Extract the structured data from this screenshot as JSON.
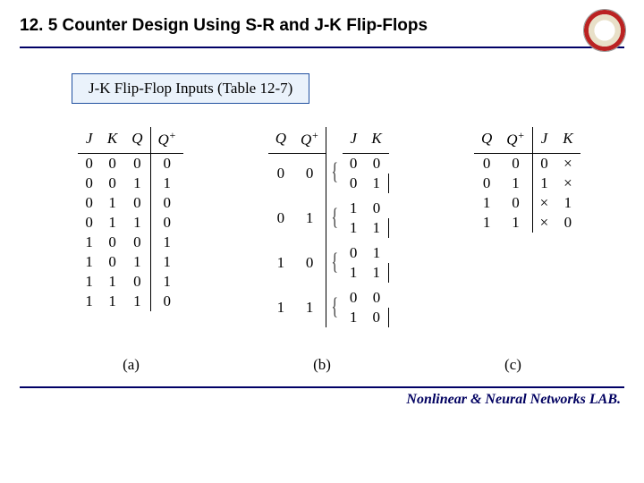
{
  "title": "12. 5 Counter Design Using S-R and J-K Flip-Flops",
  "subtitle": "J-K Flip-Flop Inputs (Table 12-7)",
  "tableA": {
    "headers": [
      "J",
      "K",
      "Q",
      "Q+"
    ],
    "rows": [
      [
        "0",
        "0",
        "0",
        "0"
      ],
      [
        "0",
        "0",
        "1",
        "1"
      ],
      [
        "0",
        "1",
        "0",
        "0"
      ],
      [
        "0",
        "1",
        "1",
        "0"
      ],
      [
        "1",
        "0",
        "0",
        "1"
      ],
      [
        "1",
        "0",
        "1",
        "1"
      ],
      [
        "1",
        "1",
        "0",
        "1"
      ],
      [
        "1",
        "1",
        "1",
        "0"
      ]
    ]
  },
  "tableB": {
    "headers": [
      "Q",
      "Q+",
      "J",
      "K"
    ],
    "groups": [
      {
        "left": [
          "0",
          "0"
        ],
        "pairs": [
          [
            "0",
            "0"
          ],
          [
            "0",
            "1"
          ]
        ]
      },
      {
        "left": [
          "0",
          "1"
        ],
        "pairs": [
          [
            "1",
            "0"
          ],
          [
            "1",
            "1"
          ]
        ]
      },
      {
        "left": [
          "1",
          "0"
        ],
        "pairs": [
          [
            "0",
            "1"
          ],
          [
            "1",
            "1"
          ]
        ]
      },
      {
        "left": [
          "1",
          "1"
        ],
        "pairs": [
          [
            "0",
            "0"
          ],
          [
            "1",
            "0"
          ]
        ]
      }
    ]
  },
  "tableC": {
    "headers": [
      "Q",
      "Q+",
      "J",
      "K"
    ],
    "rows": [
      [
        "0",
        "0",
        "0",
        "×"
      ],
      [
        "0",
        "1",
        "1",
        "×"
      ],
      [
        "1",
        "0",
        "×",
        "1"
      ],
      [
        "1",
        "1",
        "×",
        "0"
      ]
    ]
  },
  "labels": {
    "a": "(a)",
    "b": "(b)",
    "c": "(c)"
  },
  "footer": "Nonlinear & Neural Networks LAB.",
  "chart_data": {
    "type": "table",
    "description": "J-K flip-flop characteristic table, expanded brace form, and excitation table",
    "tables": [
      {
        "name": "a",
        "columns": [
          "J",
          "K",
          "Q",
          "Q+"
        ],
        "rows": [
          [
            0,
            0,
            0,
            0
          ],
          [
            0,
            0,
            1,
            1
          ],
          [
            0,
            1,
            0,
            0
          ],
          [
            0,
            1,
            1,
            0
          ],
          [
            1,
            0,
            0,
            1
          ],
          [
            1,
            0,
            1,
            1
          ],
          [
            1,
            1,
            0,
            1
          ],
          [
            1,
            1,
            1,
            0
          ]
        ]
      },
      {
        "name": "b",
        "columns": [
          "Q",
          "Q+",
          "J",
          "K"
        ],
        "rows": [
          [
            0,
            0,
            0,
            0
          ],
          [
            0,
            0,
            0,
            1
          ],
          [
            0,
            1,
            1,
            0
          ],
          [
            0,
            1,
            1,
            1
          ],
          [
            1,
            0,
            0,
            1
          ],
          [
            1,
            0,
            1,
            1
          ],
          [
            1,
            1,
            0,
            0
          ],
          [
            1,
            1,
            1,
            0
          ]
        ]
      },
      {
        "name": "c",
        "columns": [
          "Q",
          "Q+",
          "J",
          "K"
        ],
        "rows": [
          [
            "0",
            "0",
            "0",
            "×"
          ],
          [
            "0",
            "1",
            "1",
            "×"
          ],
          [
            "1",
            "0",
            "×",
            "1"
          ],
          [
            "1",
            "1",
            "×",
            "0"
          ]
        ]
      }
    ]
  }
}
